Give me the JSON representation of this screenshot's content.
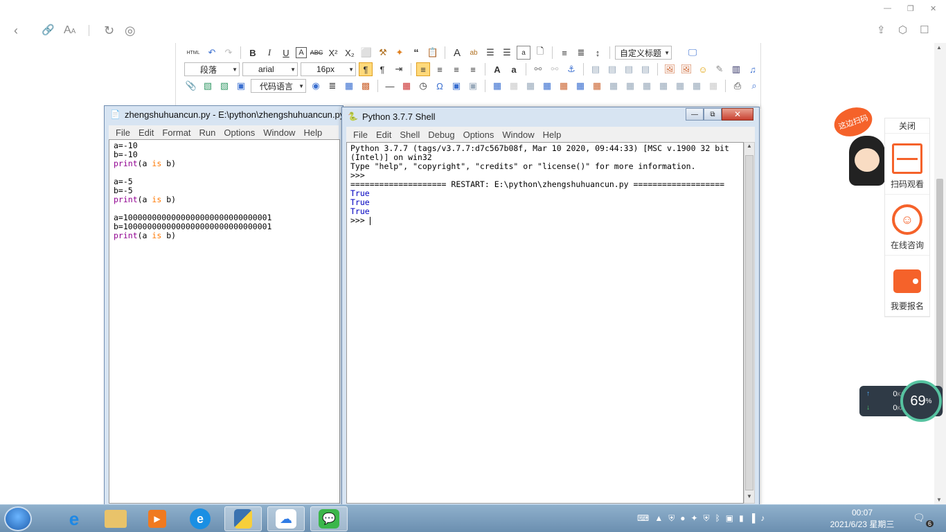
{
  "browser": {
    "window_controls": [
      "—",
      "❐",
      "✕"
    ]
  },
  "editor_toolbar": {
    "html_label": "HTML",
    "paragraph_select": "段落",
    "font_select": "arial",
    "size_select": "16px",
    "code_lang_select": "代码语言",
    "custom_title_select": "自定义标题"
  },
  "idle_editor": {
    "title": "zhengshuhuancun.py - E:\\python\\zhengshuhuancun.py",
    "menu": [
      "File",
      "Edit",
      "Format",
      "Run",
      "Options",
      "Window",
      "Help"
    ],
    "lines": [
      {
        "a": "a=-10",
        "kw": "",
        "b": ""
      },
      {
        "a": "b=-10",
        "kw": "",
        "b": ""
      },
      {
        "fn": "print",
        "rest1": "(a ",
        "kw": "is",
        "rest2": " b)"
      },
      {
        "a": "",
        "kw": "",
        "b": ""
      },
      {
        "a": "a=-5",
        "kw": "",
        "b": ""
      },
      {
        "a": "b=-5",
        "kw": "",
        "b": ""
      },
      {
        "fn": "print",
        "rest1": "(a ",
        "kw": "is",
        "rest2": " b)"
      },
      {
        "a": "",
        "kw": "",
        "b": ""
      },
      {
        "a": "a=1000000000000000000000000000001",
        "kw": "",
        "b": ""
      },
      {
        "a": "b=1000000000000000000000000000001",
        "kw": "",
        "b": ""
      },
      {
        "fn": "print",
        "rest1": "(a ",
        "kw": "is",
        "rest2": " b)"
      }
    ]
  },
  "shell": {
    "title": "Python 3.7.7 Shell",
    "menu": [
      "File",
      "Edit",
      "Shell",
      "Debug",
      "Options",
      "Window",
      "Help"
    ],
    "banner1": "Python 3.7.7 (tags/v3.7.7:d7c567b08f, Mar 10 2020, 09:44:33) [MSC v.1900 32 bit",
    "banner2": "(Intel)] on win32",
    "banner3": "Type \"help\", \"copyright\", \"credits\" or \"license()\" for more information.",
    "prompt1": ">>> ",
    "restart": "==================== RESTART: E:\\python\\zhengshuhuancun.py ===================",
    "outputs": [
      "True",
      "True",
      "True"
    ],
    "prompt2": ">>> "
  },
  "side_panel": {
    "close": "关闭",
    "badge": "这边扫码",
    "items": [
      "扫码观看",
      "在线咨询",
      "我要报名"
    ]
  },
  "net_widget": {
    "up": "0",
    "down": "0",
    "unit": "K/s",
    "percent": "69",
    "percent_sign": "%"
  },
  "taskbar": {
    "time": "00:07",
    "date": "2021/6/23 星期三",
    "notif_count": "6"
  },
  "colors": {
    "keyword_purple": "#900090",
    "keyword_orange": "#ff7700",
    "output_blue": "#0000c0",
    "sidebar_orange": "#f5622a"
  }
}
